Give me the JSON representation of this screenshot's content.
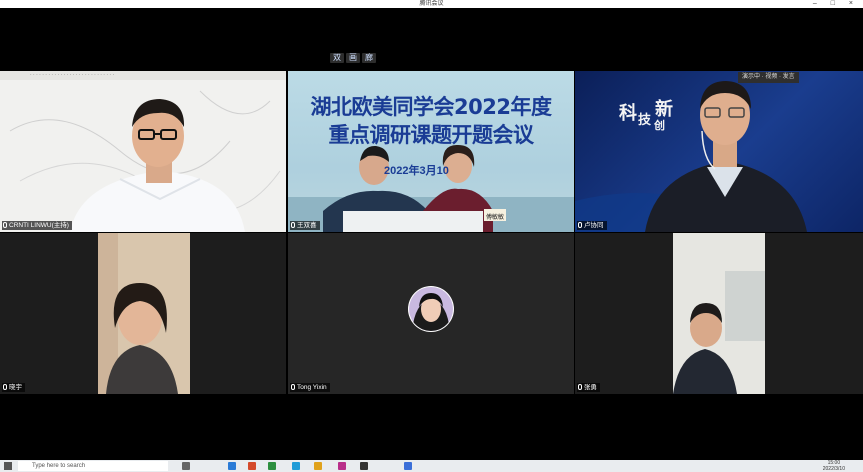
{
  "window": {
    "title": "腾讯会议"
  },
  "toolbar": {
    "items": [
      "双",
      "画",
      "廊"
    ]
  },
  "participants": [
    {
      "name": "CRNTI LINWU(主持)"
    },
    {
      "name": "王双喜"
    },
    {
      "name": "卢协同"
    },
    {
      "name": "晓宇"
    },
    {
      "name": "Tong Yixin"
    },
    {
      "name": "张勇"
    }
  ],
  "slide": {
    "line1": "湖北欧美同学会2022年度",
    "line2": "重点调研课题开题会议",
    "date": "2022年3月10",
    "sign": "傅敏敏"
  },
  "background3": {
    "chars": [
      "科",
      "技",
      "新",
      "创"
    ],
    "chip": "演示中 · 视频 · 发言"
  },
  "taskbar": {
    "search_placeholder": "Type here to search",
    "time": "15:00",
    "date": "2022/3/10"
  },
  "colors": {
    "accent": "#1a3c95",
    "taskbar": "#e9ecef"
  }
}
